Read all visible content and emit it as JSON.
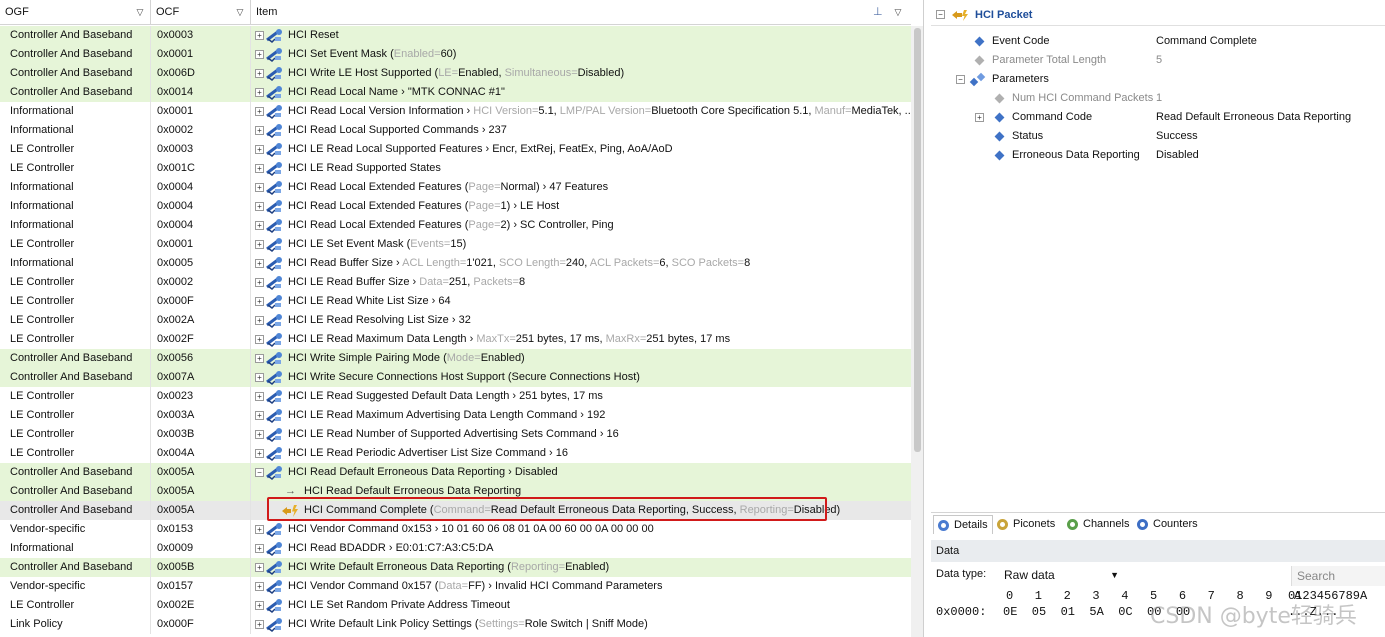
{
  "grid": {
    "headers": {
      "ogf": "OGF",
      "ocf": "OCF",
      "item": "Item"
    },
    "rows": [
      {
        "ogf": "Controller And Baseband",
        "ocf": "0x0003",
        "bg": "g",
        "icon": "cmd",
        "exp": "+",
        "parts": [
          [
            "HCI Reset",
            ""
          ]
        ]
      },
      {
        "ogf": "Controller And Baseband",
        "ocf": "0x0001",
        "bg": "g",
        "icon": "cmd",
        "exp": "+",
        "parts": [
          [
            "HCI Set Event Mask (",
            ""
          ],
          [
            "Enabled=",
            "dim"
          ],
          [
            "60)",
            ""
          ]
        ]
      },
      {
        "ogf": "Controller And Baseband",
        "ocf": "0x006D",
        "bg": "g",
        "icon": "cmd",
        "exp": "+",
        "parts": [
          [
            "HCI Write LE Host Supported (",
            ""
          ],
          [
            "LE=",
            "dim"
          ],
          [
            "Enabled, ",
            ""
          ],
          [
            "Simultaneous=",
            "dim"
          ],
          [
            "Disabled)",
            ""
          ]
        ]
      },
      {
        "ogf": "Controller And Baseband",
        "ocf": "0x0014",
        "bg": "g",
        "icon": "cmd",
        "exp": "+",
        "parts": [
          [
            "HCI Read Local Name › \"MTK CONNAC #1\"",
            ""
          ]
        ]
      },
      {
        "ogf": "Informational",
        "ocf": "0x0001",
        "bg": "w",
        "icon": "cmd",
        "exp": "+",
        "parts": [
          [
            "HCI Read Local Version Information › ",
            ""
          ],
          [
            "HCI Version=",
            "dim"
          ],
          [
            "5.1, ",
            ""
          ],
          [
            "LMP/PAL Version=",
            "dim"
          ],
          [
            "Bluetooth Core Specification 5.1, ",
            ""
          ],
          [
            "Manuf=",
            "dim"
          ],
          [
            "MediaTek, ...",
            ""
          ]
        ]
      },
      {
        "ogf": "Informational",
        "ocf": "0x0002",
        "bg": "w",
        "icon": "cmd",
        "exp": "+",
        "parts": [
          [
            "HCI Read Local Supported Commands › 237",
            ""
          ]
        ]
      },
      {
        "ogf": "LE Controller",
        "ocf": "0x0003",
        "bg": "w",
        "icon": "cmd",
        "exp": "+",
        "parts": [
          [
            "HCI LE Read Local Supported Features › Encr, ExtRej, FeatEx, Ping, AoA/AoD",
            ""
          ]
        ]
      },
      {
        "ogf": "LE Controller",
        "ocf": "0x001C",
        "bg": "w",
        "icon": "cmd",
        "exp": "+",
        "parts": [
          [
            "HCI LE Read Supported States",
            ""
          ]
        ]
      },
      {
        "ogf": "Informational",
        "ocf": "0x0004",
        "bg": "w",
        "icon": "cmd",
        "exp": "+",
        "parts": [
          [
            "HCI Read Local Extended Features (",
            ""
          ],
          [
            "Page=",
            "dim"
          ],
          [
            "Normal) › 47 Features",
            ""
          ]
        ]
      },
      {
        "ogf": "Informational",
        "ocf": "0x0004",
        "bg": "w",
        "icon": "cmd",
        "exp": "+",
        "parts": [
          [
            "HCI Read Local Extended Features (",
            ""
          ],
          [
            "Page=",
            "dim"
          ],
          [
            "1) › LE Host",
            ""
          ]
        ]
      },
      {
        "ogf": "Informational",
        "ocf": "0x0004",
        "bg": "w",
        "icon": "cmd",
        "exp": "+",
        "parts": [
          [
            "HCI Read Local Extended Features (",
            ""
          ],
          [
            "Page=",
            "dim"
          ],
          [
            "2) › SC Controller, Ping",
            ""
          ]
        ]
      },
      {
        "ogf": "LE Controller",
        "ocf": "0x0001",
        "bg": "w",
        "icon": "cmd",
        "exp": "+",
        "parts": [
          [
            "HCI LE Set Event Mask (",
            ""
          ],
          [
            "Events=",
            "dim"
          ],
          [
            "15)",
            ""
          ]
        ]
      },
      {
        "ogf": "Informational",
        "ocf": "0x0005",
        "bg": "w",
        "icon": "cmd",
        "exp": "+",
        "parts": [
          [
            "HCI Read Buffer Size › ",
            ""
          ],
          [
            "ACL Length=",
            "dim"
          ],
          [
            "1'021, ",
            ""
          ],
          [
            "SCO Length=",
            "dim"
          ],
          [
            "240, ",
            ""
          ],
          [
            "ACL Packets=",
            "dim"
          ],
          [
            "6, ",
            ""
          ],
          [
            "SCO Packets=",
            "dim"
          ],
          [
            "8",
            ""
          ]
        ]
      },
      {
        "ogf": "LE Controller",
        "ocf": "0x0002",
        "bg": "w",
        "icon": "cmd",
        "exp": "+",
        "parts": [
          [
            "HCI LE Read Buffer Size › ",
            ""
          ],
          [
            "Data=",
            "dim"
          ],
          [
            "251, ",
            ""
          ],
          [
            "Packets=",
            "dim"
          ],
          [
            "8",
            ""
          ]
        ]
      },
      {
        "ogf": "LE Controller",
        "ocf": "0x000F",
        "bg": "w",
        "icon": "cmd",
        "exp": "+",
        "parts": [
          [
            "HCI LE Read White List Size › 64",
            ""
          ]
        ]
      },
      {
        "ogf": "LE Controller",
        "ocf": "0x002A",
        "bg": "w",
        "icon": "cmd",
        "exp": "+",
        "parts": [
          [
            "HCI LE Read Resolving List Size › 32",
            ""
          ]
        ]
      },
      {
        "ogf": "LE Controller",
        "ocf": "0x002F",
        "bg": "w",
        "icon": "cmd",
        "exp": "+",
        "parts": [
          [
            "HCI LE Read Maximum Data Length › ",
            ""
          ],
          [
            "MaxTx=",
            "dim"
          ],
          [
            "251 bytes, 17 ms, ",
            ""
          ],
          [
            "MaxRx=",
            "dim"
          ],
          [
            "251 bytes, 17 ms",
            ""
          ]
        ]
      },
      {
        "ogf": "Controller And Baseband",
        "ocf": "0x0056",
        "bg": "g",
        "icon": "cmd",
        "exp": "+",
        "parts": [
          [
            "HCI Write Simple Pairing Mode (",
            ""
          ],
          [
            "Mode=",
            "dim"
          ],
          [
            "Enabled)",
            ""
          ]
        ]
      },
      {
        "ogf": "Controller And Baseband",
        "ocf": "0x007A",
        "bg": "g",
        "icon": "cmd",
        "exp": "+",
        "parts": [
          [
            "HCI Write Secure Connections Host Support (Secure Connections Host)",
            ""
          ]
        ]
      },
      {
        "ogf": "LE Controller",
        "ocf": "0x0023",
        "bg": "w",
        "icon": "cmd",
        "exp": "+",
        "parts": [
          [
            "HCI LE Read Suggested Default Data Length › 251 bytes, 17 ms",
            ""
          ]
        ]
      },
      {
        "ogf": "LE Controller",
        "ocf": "0x003A",
        "bg": "w",
        "icon": "cmd",
        "exp": "+",
        "parts": [
          [
            "HCI LE Read Maximum Advertising Data Length Command › 192",
            ""
          ]
        ]
      },
      {
        "ogf": "LE Controller",
        "ocf": "0x003B",
        "bg": "w",
        "icon": "cmd",
        "exp": "+",
        "parts": [
          [
            "HCI LE Read Number of Supported Advertising Sets Command › 16",
            ""
          ]
        ]
      },
      {
        "ogf": "LE Controller",
        "ocf": "0x004A",
        "bg": "w",
        "icon": "cmd",
        "exp": "+",
        "parts": [
          [
            "HCI LE Read Periodic Advertiser List Size Command › 16",
            ""
          ]
        ]
      },
      {
        "ogf": "Controller And Baseband",
        "ocf": "0x005A",
        "bg": "g",
        "icon": "cmd",
        "exp": "−",
        "parts": [
          [
            "HCI Read Default Erroneous Data Reporting › Disabled",
            ""
          ]
        ]
      },
      {
        "ogf": "Controller And Baseband",
        "ocf": "0x005A",
        "bg": "g",
        "icon": "arrow",
        "exp": "",
        "parts": [
          [
            "HCI Read Default Erroneous Data Reporting",
            ""
          ]
        ]
      },
      {
        "ogf": "Controller And Baseband",
        "ocf": "0x005A",
        "bg": "sel",
        "icon": "event",
        "exp": "",
        "parts": [
          [
            "HCI Command Complete (",
            ""
          ],
          [
            "Command=",
            "dim"
          ],
          [
            "Read Default Erroneous Data Reporting, Success, ",
            ""
          ],
          [
            "Reporting=",
            "dim"
          ],
          [
            "Disabled)",
            ""
          ]
        ]
      },
      {
        "ogf": "Vendor-specific",
        "ocf": "0x0153",
        "bg": "w",
        "icon": "cmd",
        "exp": "+",
        "parts": [
          [
            "HCI Vendor Command 0x153 › 10 01 60 06 08 01 0A 00 60 00 0A 00 00 00",
            ""
          ]
        ]
      },
      {
        "ogf": "Informational",
        "ocf": "0x0009",
        "bg": "w",
        "icon": "cmd",
        "exp": "+",
        "parts": [
          [
            "HCI Read BDADDR › E0:01:C7:A3:C5:DA",
            ""
          ]
        ]
      },
      {
        "ogf": "Controller And Baseband",
        "ocf": "0x005B",
        "bg": "g",
        "icon": "cmd",
        "exp": "+",
        "parts": [
          [
            "HCI Write Default Erroneous Data Reporting (",
            ""
          ],
          [
            "Reporting=",
            "dim"
          ],
          [
            "Enabled)",
            ""
          ]
        ]
      },
      {
        "ogf": "Vendor-specific",
        "ocf": "0x0157",
        "bg": "w",
        "icon": "cmd",
        "exp": "+",
        "parts": [
          [
            "HCI Vendor Command 0x157 (",
            ""
          ],
          [
            "Data=",
            "dim"
          ],
          [
            "FF) › Invalid HCI Command Parameters",
            ""
          ]
        ]
      },
      {
        "ogf": "LE Controller",
        "ocf": "0x002E",
        "bg": "w",
        "icon": "cmd",
        "exp": "+",
        "parts": [
          [
            "HCI LE Set Random Private Address Timeout",
            ""
          ]
        ]
      },
      {
        "ogf": "Link Policy",
        "ocf": "0x000F",
        "bg": "w",
        "icon": "cmd",
        "exp": "+",
        "parts": [
          [
            "HCI Write Default Link Policy Settings (",
            ""
          ],
          [
            "Settings=",
            "dim"
          ],
          [
            "Role Switch | Sniff Mode)",
            ""
          ]
        ]
      }
    ]
  },
  "packet": {
    "title": "HCI Packet",
    "fields": [
      {
        "label": "Event Code",
        "value": "Command Complete",
        "indent": 0,
        "style": "normal",
        "expander": ""
      },
      {
        "label": "Parameter Total Length",
        "value": "5",
        "indent": 0,
        "style": "gray",
        "expander": ""
      },
      {
        "label": "Parameters",
        "value": "",
        "indent": 0,
        "style": "group",
        "expander": "−"
      },
      {
        "label": "Num HCI Command Packets",
        "value": "1",
        "indent": 1,
        "style": "gray",
        "expander": ""
      },
      {
        "label": "Command Code",
        "value": "Read Default Erroneous Data Reporting",
        "indent": 1,
        "style": "normal",
        "expander": "+"
      },
      {
        "label": "Status",
        "value": "Success",
        "indent": 1,
        "style": "normal",
        "expander": ""
      },
      {
        "label": "Erroneous Data Reporting",
        "value": "Disabled",
        "indent": 1,
        "style": "normal",
        "expander": ""
      }
    ]
  },
  "tabs": [
    "Details",
    "Piconets",
    "Channels",
    "Counters"
  ],
  "data_panel": {
    "title": "Data",
    "type_label": "Data type:",
    "type_value": "Raw data",
    "search_placeholder": "Search",
    "hex_header": "0   1   2   3   4   5   6   7   8   9   A",
    "ascii_header": "0123456789A",
    "offset": "0x0000:",
    "bytes": "0E  05  01  5A  0C  00  00",
    "ascii": "...Z..."
  },
  "watermark": "CSDN @byte轻骑兵",
  "colors": {
    "green_row": "#e6f5d8",
    "selected_row": "#e8e8e8",
    "highlight_box": "#d11a1a",
    "accent": "#3f72c6"
  }
}
